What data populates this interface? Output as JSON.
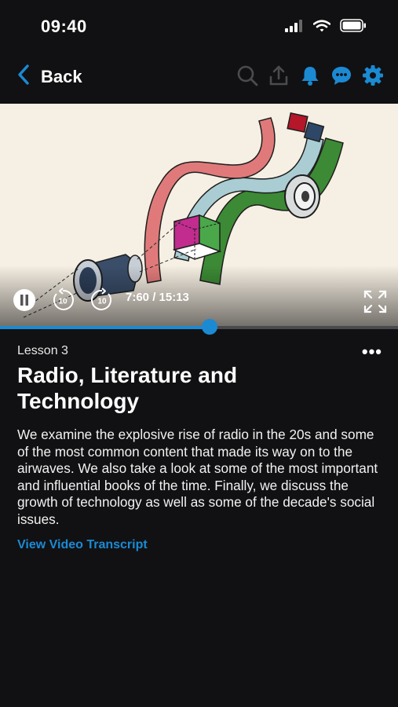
{
  "status": {
    "time": "09:40"
  },
  "nav": {
    "back_label": "Back"
  },
  "player": {
    "time_readout": "7:60 / 15:13",
    "skip_back_label": "10",
    "skip_forward_label": "10",
    "progress_fraction": 0.527
  },
  "lesson": {
    "number_label": "Lesson 3",
    "title": "Radio, Literature and Technology",
    "description": "We examine the explosive rise of radio in the 20s and some of the most common content that made its way on to the airwaves. We also take a look at some of the most important and influential books of the time. Finally, we discuss the growth of technology as well as some of the decade's social issues.",
    "more_label": "•••",
    "transcript_link": "View Video Transcript"
  },
  "colors": {
    "accent": "#1b8ad3",
    "background": "#111113",
    "video_bg": "#f6efe3"
  }
}
